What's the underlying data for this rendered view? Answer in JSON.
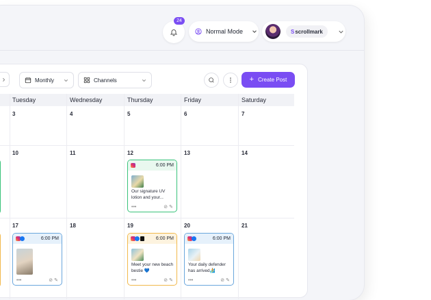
{
  "header": {
    "notification_count": "24",
    "mode_label": "Normal Mode",
    "brand_prefix": "S",
    "brand_label": "scrollmark"
  },
  "toolbar": {
    "view_label": "Monthly",
    "channels_label": "Channels",
    "create_label": "Create Post"
  },
  "days": [
    "Tuesday",
    "Wednesday",
    "Thursday",
    "Friday",
    "Saturday"
  ],
  "weeks": [
    [
      "3",
      "4",
      "5",
      "6",
      "7"
    ],
    [
      "10",
      "11",
      "12",
      "13",
      "14"
    ],
    [
      "17",
      "18",
      "19",
      "20",
      "21"
    ]
  ],
  "posts": [
    {
      "time": "6:00 PM",
      "caption": "Our signature UV lotion and your...",
      "networks": [
        "instagram"
      ],
      "color": "#38c27a"
    },
    {
      "time": "6:00 PM",
      "caption": "",
      "networks": [
        "instagram",
        "facebook"
      ],
      "color": "#6aa6dc"
    },
    {
      "time": "6:00 PM",
      "caption": "Meet your new beach bestie 💙",
      "networks": [
        "instagram",
        "facebook",
        "tiktok"
      ],
      "color": "#f1b84b"
    },
    {
      "time": "6:00 PM",
      "caption": "Your daily defender has arrived🏄",
      "networks": [
        "instagram",
        "facebook"
      ],
      "color": "#6aa6dc"
    }
  ],
  "icons": {
    "bell": "bell-icon",
    "mode": "user-circle-icon",
    "calendar": "calendar-icon",
    "channels": "grid-icon",
    "search": "search-icon",
    "more": "more-vertical-icon"
  },
  "accent_color": "#7a4df3"
}
